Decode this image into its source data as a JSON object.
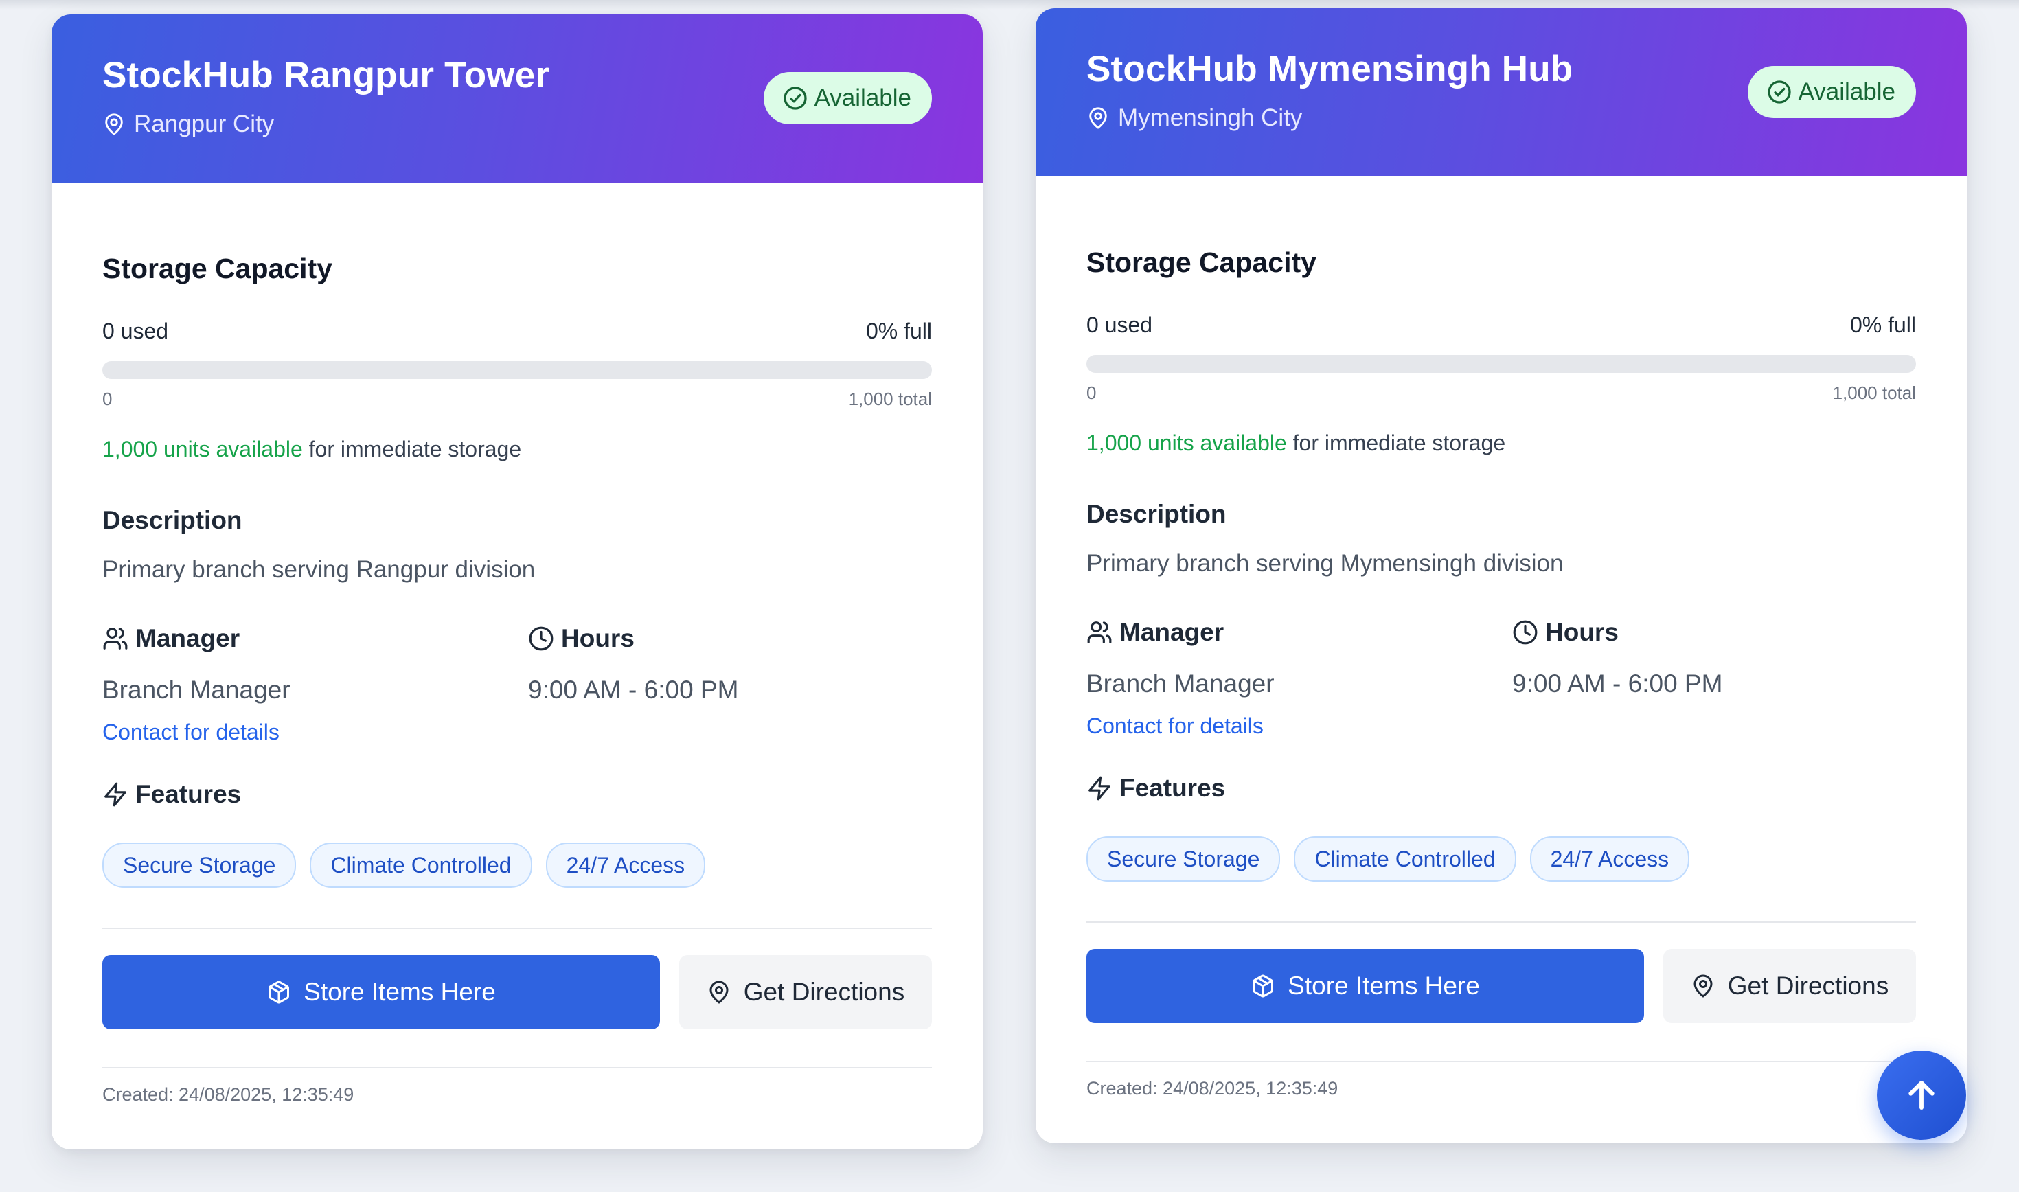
{
  "warehouses": [
    {
      "name": "StockHub Rangpur Tower",
      "location": "Rangpur City",
      "status": "Available",
      "storage_heading": "Storage Capacity",
      "used_text": "0 used",
      "full_text": "0% full",
      "fill_percent": 0,
      "range_min": "0",
      "range_total": "1,000 total",
      "available_highlight": "1,000 units available",
      "available_suffix": " for immediate storage",
      "description_heading": "Description",
      "description": "Primary branch serving Rangpur division",
      "manager_heading": "Manager",
      "manager": "Branch Manager",
      "contact_link": "Contact for details",
      "hours_heading": "Hours",
      "hours": "9:00 AM - 6:00 PM",
      "features_heading": "Features",
      "features": [
        "Secure Storage",
        "Climate Controlled",
        "24/7 Access"
      ],
      "store_button": "Store Items Here",
      "directions_button": "Get Directions",
      "created": "Created: 24/08/2025, 12:35:49"
    },
    {
      "name": "StockHub Mymensingh Hub",
      "location": "Mymensingh City",
      "status": "Available",
      "storage_heading": "Storage Capacity",
      "used_text": "0 used",
      "full_text": "0% full",
      "fill_percent": 0,
      "range_min": "0",
      "range_total": "1,000 total",
      "available_highlight": "1,000 units available",
      "available_suffix": " for immediate storage",
      "description_heading": "Description",
      "description": "Primary branch serving Mymensingh division",
      "manager_heading": "Manager",
      "manager": "Branch Manager",
      "contact_link": "Contact for details",
      "hours_heading": "Hours",
      "hours": "9:00 AM - 6:00 PM",
      "features_heading": "Features",
      "features": [
        "Secure Storage",
        "Climate Controlled",
        "24/7 Access"
      ],
      "store_button": "Store Items Here",
      "directions_button": "Get Directions",
      "created": "Created: 24/08/2025, 12:35:49"
    }
  ],
  "icons": {
    "location": "map-pin-icon",
    "status": "check-circle-icon",
    "manager": "users-icon",
    "hours": "clock-icon",
    "features": "lightning-icon",
    "store": "package-icon",
    "directions": "map-pin-icon",
    "scroll_top": "arrow-up-icon"
  },
  "colors": {
    "header_gradient_start": "#3a5fe0",
    "header_gradient_end": "#8a35df",
    "primary": "#2f63e0",
    "available_green": "#16a34a",
    "badge_bg": "#dcfce7",
    "link_blue": "#2563eb"
  }
}
